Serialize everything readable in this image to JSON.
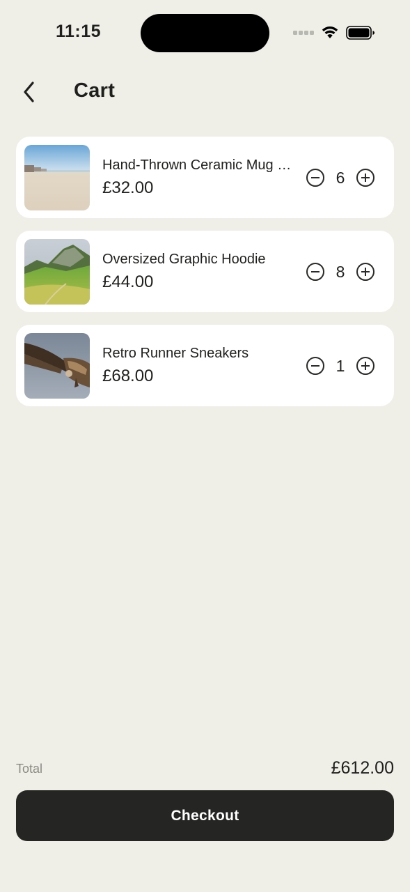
{
  "status_bar": {
    "time": "11:15"
  },
  "header": {
    "title": "Cart",
    "back_icon": "chevron-left-icon"
  },
  "cart": {
    "items": [
      {
        "name": "Hand-Thrown Ceramic Mug Set",
        "price": "£32.00",
        "quantity": "6",
        "image": "beach-photo"
      },
      {
        "name": "Oversized Graphic Hoodie",
        "price": "£44.00",
        "quantity": "8",
        "image": "mountain-meadow-photo"
      },
      {
        "name": "Retro Runner Sneakers",
        "price": "£68.00",
        "quantity": "1",
        "image": "vulture-photo"
      }
    ]
  },
  "summary": {
    "total_label": "Total",
    "total_value": "£612.00",
    "checkout_label": "Checkout"
  },
  "colors": {
    "background": "#f0efe7",
    "card": "#ffffff",
    "checkout_button": "#252523",
    "muted_text": "#8a8983"
  }
}
